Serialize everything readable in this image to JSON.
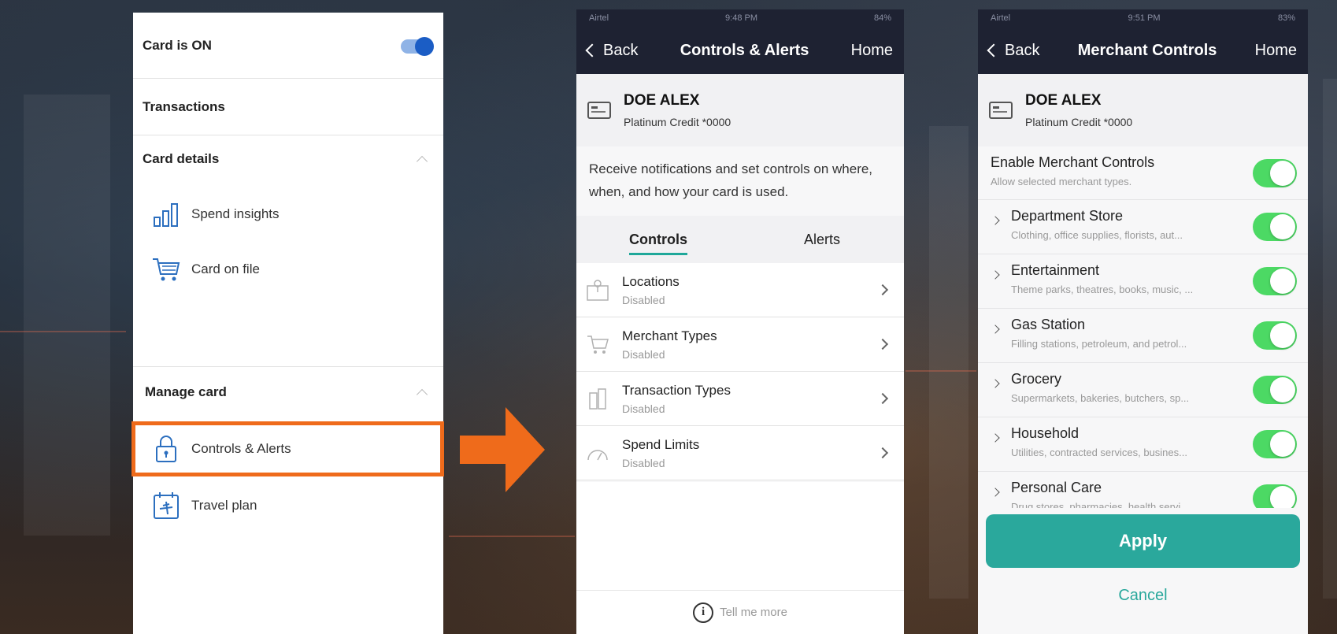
{
  "panel1": {
    "card_status": "Card is ON",
    "transactions": "Transactions",
    "card_details": "Card details",
    "spend_insights": "Spend insights",
    "card_on_file": "Card on file",
    "manage_card": "Manage card",
    "controls_alerts": "Controls & Alerts",
    "travel_plan": "Travel plan"
  },
  "panel2": {
    "status": {
      "carrier": "Airtel",
      "time": "9:48 PM",
      "battery": "84%"
    },
    "nav": {
      "back": "Back",
      "title": "Controls & Alerts",
      "home": "Home"
    },
    "card": {
      "name": "DOE ALEX",
      "type": "Platinum Credit *0000"
    },
    "description": "Receive notifications and set controls on where, when, and how your card is used.",
    "tabs": [
      "Controls",
      "Alerts"
    ],
    "rows": [
      {
        "title": "Locations",
        "status": "Disabled"
      },
      {
        "title": "Merchant Types",
        "status": "Disabled"
      },
      {
        "title": "Transaction Types",
        "status": "Disabled"
      },
      {
        "title": "Spend Limits",
        "status": "Disabled"
      }
    ],
    "footer": "Tell me more"
  },
  "panel3": {
    "status": {
      "carrier": "Airtel",
      "time": "9:51 PM",
      "battery": "83%"
    },
    "nav": {
      "back": "Back",
      "title": "Merchant Controls",
      "home": "Home"
    },
    "card": {
      "name": "DOE ALEX",
      "type": "Platinum Credit *0000"
    },
    "enable": {
      "title": "Enable Merchant Controls",
      "sub": "Allow selected merchant types."
    },
    "categories": [
      {
        "title": "Department Store",
        "sub": "Clothing, office supplies, florists, aut..."
      },
      {
        "title": "Entertainment",
        "sub": "Theme parks, theatres, books, music, ..."
      },
      {
        "title": "Gas Station",
        "sub": "Filling stations, petroleum, and petrol..."
      },
      {
        "title": "Grocery",
        "sub": "Supermarkets, bakeries, butchers, sp..."
      },
      {
        "title": "Household",
        "sub": "Utilities, contracted services, busines..."
      },
      {
        "title": "Personal Care",
        "sub": "Drug stores, pharmacies, health servi..."
      }
    ],
    "apply": "Apply",
    "cancel": "Cancel"
  },
  "colors": {
    "accent": "#2aa89c",
    "highlight": "#ef6b1b",
    "toggle_on": "#4cd964",
    "nav_bg": "#1e2232"
  }
}
